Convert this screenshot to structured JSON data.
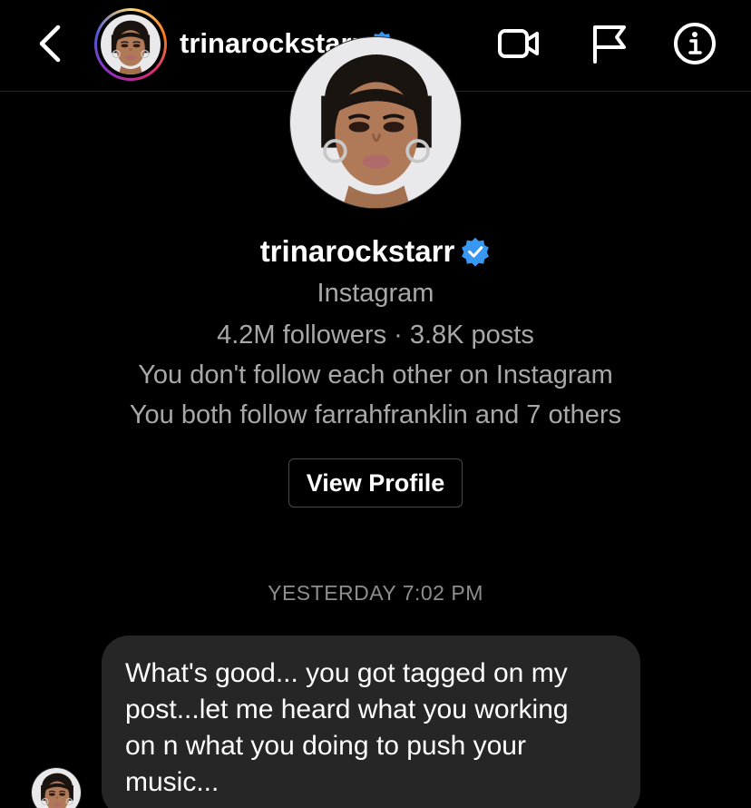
{
  "header": {
    "username": "trinarockstarr",
    "icons": {
      "back": "chevron-left-icon",
      "video": "video-call-icon",
      "flag": "flag-icon",
      "info": "info-icon",
      "verified": "verified-badge-icon"
    }
  },
  "profile": {
    "name": "trinarockstarr",
    "subtitle": "Instagram",
    "stats": "4.2M followers · 3.8K posts",
    "follow_status": "You don't follow each other on Instagram",
    "mutual": "You both follow farrahfranklin and 7 others",
    "view_profile_label": "View Profile"
  },
  "conversation": {
    "timestamp": "YESTERDAY 7:02 PM",
    "messages": [
      {
        "sender": "trinarockstarr",
        "text": "What's good... you got tagged on my\npost...let me heard what you working\non n what you doing to push your\nmusic..."
      }
    ]
  },
  "colors": {
    "background": "#000000",
    "bubble": "#262626",
    "secondary_text": "#a8a8a8",
    "timestamp_text": "#8e8e8e",
    "verified_blue": "#3897f0"
  }
}
